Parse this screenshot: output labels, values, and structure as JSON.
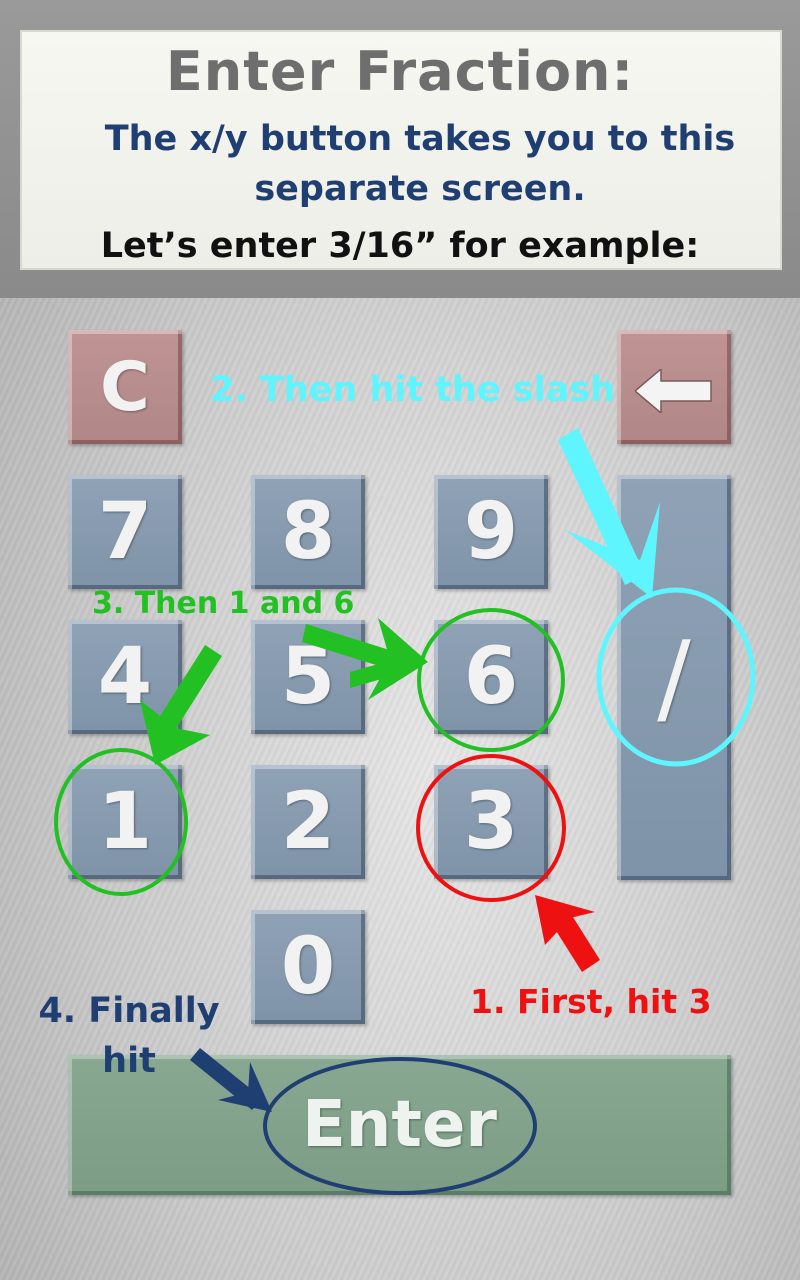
{
  "header": {
    "title": "Enter Fraction:",
    "subtitle": "The x/y button takes you to this separate screen.",
    "example": "Let’s enter 3/16” for example:"
  },
  "keypad": {
    "clear": "C",
    "backspace_icon": "left-arrow-icon",
    "slash": "/",
    "digits": {
      "seven": "7",
      "eight": "8",
      "nine": "9",
      "four": "4",
      "five": "5",
      "six": "6",
      "one": "1",
      "two": "2",
      "three": "3",
      "zero": "0"
    },
    "enter": "Enter"
  },
  "annotations": {
    "step1": "1. First, hit 3",
    "step2": "2. Then hit the slash",
    "step3": "3. Then 1 and 6",
    "step4": "4. Finally hit"
  },
  "colors": {
    "step1": "#ee1111",
    "step2": "#5ff5ff",
    "step3": "#22c022",
    "step4": "#1f3f73"
  }
}
